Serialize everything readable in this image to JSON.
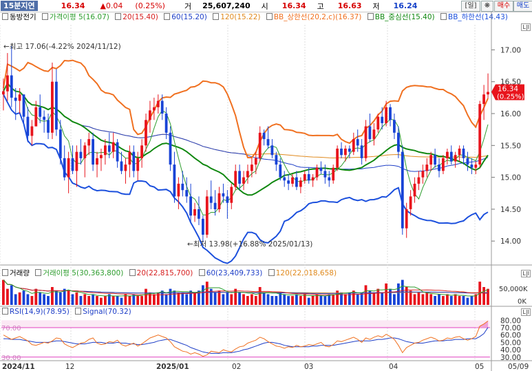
{
  "header": {
    "title": "15분지연",
    "price": "16.34",
    "change": "▲0.04",
    "change_pct": "(0.25%)",
    "volume_label": "거",
    "volume": "25,607,240",
    "open_label": "시",
    "open": "16.34",
    "high_label": "고",
    "high": "16.63",
    "low_label": "저",
    "low": "16.24",
    "period_button": "[일]",
    "settings_icon": "gear-icon",
    "buy_button": "매수",
    "sell_button": "매도"
  },
  "price_legend": {
    "stock_name": "동방전기",
    "items": [
      {
        "text": "가격이평 5(16.07)",
        "color": "#2e9d2e"
      },
      {
        "text": "20(15.40)",
        "color": "#d62020"
      },
      {
        "text": "60(15.20)",
        "color": "#1f3fc7"
      },
      {
        "text": "120(15.22)",
        "color": "#e08a1e"
      },
      {
        "text": "BB_상한선(20,2,c)(16.37)",
        "color": "#f07020"
      },
      {
        "text": "BB_중심선(15.40)",
        "color": "#118811"
      },
      {
        "text": "BB_하한선(14.43)",
        "color": "#1c50dd"
      }
    ]
  },
  "volume_legend": {
    "items": [
      {
        "text": "거래량",
        "color": "#000000"
      },
      {
        "text": "거래이평 5(30,363,800)",
        "color": "#2e9d2e"
      },
      {
        "text": "20(22,815,700)",
        "color": "#d62020"
      },
      {
        "text": "60(23,409,733)",
        "color": "#1f3fc7"
      },
      {
        "text": "120(22,018,658)",
        "color": "#e08a1e"
      }
    ]
  },
  "rsi_legend": {
    "items": [
      {
        "text": "RSI(14,9)(78.95)",
        "color": "#1f3fc7"
      },
      {
        "text": "Signal(70.32)",
        "color": "#1f3fc7"
      }
    ]
  },
  "annotations": {
    "high": "←최고 17.06(-4.22% 2024/11/12)",
    "low": "←최저 13.98(+16.88% 2025/01/13)"
  },
  "price_marker": {
    "value": "16.34",
    "pct": "(0.25%)"
  },
  "colors": {
    "up": "#e8141c",
    "down": "#1843d6"
  },
  "chart_data": {
    "type": "candlestick",
    "x_ticks": [
      "2024/11",
      "12",
      "2025/01",
      "02",
      "03",
      "04",
      "05",
      "05/09"
    ],
    "price_axis": {
      "ticks": [
        14.0,
        14.5,
        15.0,
        15.5,
        16.0,
        16.5,
        17.0
      ],
      "range": [
        13.7,
        17.35
      ]
    },
    "volume_axis": {
      "ticks": [
        "50,000K",
        "0K"
      ]
    },
    "rsi_axis": {
      "ticks": [
        30,
        40,
        50,
        60,
        70,
        80
      ],
      "range": [
        27,
        85
      ],
      "overbought": 70,
      "oversold": 30
    },
    "candles": [
      [
        16.3,
        16.55,
        16.05,
        16.35
      ],
      [
        16.35,
        16.95,
        16.2,
        16.6
      ],
      [
        16.6,
        17.06,
        16.1,
        16.25
      ],
      [
        16.25,
        16.4,
        15.9,
        16.2
      ],
      [
        16.2,
        16.4,
        16.0,
        16.3
      ],
      [
        16.3,
        16.3,
        15.85,
        15.95
      ],
      [
        15.95,
        16.1,
        15.55,
        15.65
      ],
      [
        15.65,
        15.9,
        15.5,
        15.8
      ],
      [
        15.8,
        16.2,
        15.8,
        16.1
      ],
      [
        16.1,
        16.3,
        15.85,
        15.95
      ],
      [
        15.95,
        16.05,
        15.7,
        15.9
      ],
      [
        15.9,
        16.0,
        15.6,
        15.7
      ],
      [
        15.7,
        16.8,
        15.6,
        16.5
      ],
      [
        16.5,
        16.7,
        15.65,
        15.75
      ],
      [
        15.75,
        15.9,
        15.2,
        15.3
      ],
      [
        15.3,
        15.5,
        14.95,
        15.0
      ],
      [
        15.0,
        15.4,
        14.75,
        15.3
      ],
      [
        15.3,
        15.5,
        15.05,
        15.1
      ],
      [
        15.1,
        15.5,
        14.85,
        15.4
      ],
      [
        15.4,
        15.6,
        15.2,
        15.3
      ],
      [
        15.3,
        15.55,
        15.0,
        15.5
      ],
      [
        15.5,
        15.7,
        15.35,
        15.6
      ],
      [
        15.6,
        15.7,
        15.1,
        15.2
      ],
      [
        15.2,
        15.4,
        15.0,
        15.3
      ],
      [
        15.3,
        15.45,
        15.1,
        15.35
      ],
      [
        15.35,
        15.6,
        15.2,
        15.5
      ],
      [
        15.5,
        15.7,
        15.3,
        15.4
      ],
      [
        15.4,
        15.7,
        15.3,
        15.55
      ],
      [
        15.55,
        15.6,
        15.15,
        15.25
      ],
      [
        15.25,
        15.4,
        15.05,
        15.1
      ],
      [
        15.1,
        15.3,
        14.9,
        15.2
      ],
      [
        15.2,
        15.5,
        15.0,
        15.4
      ],
      [
        15.4,
        15.5,
        15.0,
        15.1
      ],
      [
        15.1,
        15.4,
        14.95,
        15.3
      ],
      [
        15.3,
        15.6,
        15.15,
        15.5
      ],
      [
        15.5,
        16.0,
        15.4,
        15.9
      ],
      [
        15.9,
        16.2,
        15.7,
        16.05
      ],
      [
        16.05,
        16.25,
        15.9,
        16.1
      ],
      [
        16.1,
        16.3,
        16.0,
        16.2
      ],
      [
        16.2,
        16.3,
        15.9,
        16.0
      ],
      [
        16.0,
        16.1,
        15.6,
        15.7
      ],
      [
        15.7,
        15.8,
        15.1,
        15.2
      ],
      [
        15.2,
        15.4,
        14.6,
        14.7
      ],
      [
        14.7,
        15.0,
        14.5,
        14.9
      ],
      [
        14.9,
        15.1,
        14.7,
        14.8
      ],
      [
        14.8,
        15.0,
        14.6,
        14.7
      ],
      [
        14.7,
        14.9,
        14.3,
        14.4
      ],
      [
        14.4,
        14.6,
        14.3,
        14.5
      ],
      [
        14.5,
        14.7,
        14.25,
        14.35
      ],
      [
        14.35,
        14.4,
        13.98,
        14.1
      ],
      [
        14.1,
        14.8,
        14.05,
        14.7
      ],
      [
        14.7,
        14.95,
        14.5,
        14.6
      ],
      [
        14.6,
        14.8,
        14.4,
        14.5
      ],
      [
        14.5,
        14.85,
        14.45,
        14.75
      ],
      [
        14.75,
        14.9,
        14.6,
        14.7
      ],
      [
        14.7,
        14.8,
        14.35,
        14.6
      ],
      [
        14.6,
        14.9,
        14.5,
        14.85
      ],
      [
        14.85,
        15.2,
        14.8,
        15.1
      ],
      [
        15.1,
        15.2,
        14.8,
        14.9
      ],
      [
        14.9,
        15.1,
        14.8,
        15.0
      ],
      [
        15.0,
        15.2,
        14.9,
        15.1
      ],
      [
        15.1,
        15.3,
        15.0,
        15.2
      ],
      [
        15.2,
        15.4,
        15.05,
        15.3
      ],
      [
        15.3,
        15.8,
        15.25,
        15.7
      ],
      [
        15.7,
        15.75,
        15.5,
        15.6
      ],
      [
        15.6,
        15.8,
        15.45,
        15.5
      ],
      [
        15.5,
        15.6,
        15.3,
        15.35
      ],
      [
        15.35,
        15.4,
        15.1,
        15.2
      ],
      [
        15.2,
        15.3,
        14.95,
        15.0
      ],
      [
        15.0,
        15.1,
        14.85,
        14.95
      ],
      [
        14.95,
        15.05,
        14.8,
        14.9
      ],
      [
        14.9,
        15.05,
        14.85,
        15.0
      ],
      [
        15.0,
        15.1,
        14.8,
        14.85
      ],
      [
        14.85,
        15.0,
        14.75,
        14.95
      ],
      [
        14.95,
        15.1,
        14.9,
        15.05
      ],
      [
        15.05,
        15.15,
        14.9,
        14.95
      ],
      [
        14.95,
        15.05,
        14.85,
        15.0
      ],
      [
        15.0,
        15.2,
        14.95,
        15.15
      ],
      [
        15.15,
        15.25,
        15.05,
        15.1
      ],
      [
        15.1,
        15.2,
        14.9,
        15.0
      ],
      [
        15.0,
        15.1,
        14.85,
        14.95
      ],
      [
        14.95,
        15.2,
        14.9,
        15.15
      ],
      [
        15.15,
        15.5,
        15.1,
        15.45
      ],
      [
        15.45,
        15.55,
        15.3,
        15.35
      ],
      [
        15.35,
        15.5,
        15.25,
        15.45
      ],
      [
        15.45,
        15.5,
        15.3,
        15.4
      ],
      [
        15.4,
        15.7,
        15.35,
        15.6
      ],
      [
        15.6,
        15.75,
        15.4,
        15.5
      ],
      [
        15.5,
        15.6,
        15.2,
        15.3
      ],
      [
        15.3,
        15.9,
        15.25,
        15.8
      ],
      [
        15.8,
        16.0,
        15.55,
        15.6
      ],
      [
        15.6,
        15.85,
        15.5,
        15.75
      ],
      [
        15.75,
        16.0,
        15.7,
        15.95
      ],
      [
        15.95,
        16.1,
        15.75,
        15.85
      ],
      [
        15.85,
        16.2,
        15.8,
        16.1
      ],
      [
        16.1,
        16.15,
        15.8,
        15.9
      ],
      [
        15.9,
        16.0,
        15.6,
        15.7
      ],
      [
        15.7,
        15.8,
        15.3,
        15.4
      ],
      [
        15.4,
        15.5,
        14.1,
        14.2
      ],
      [
        14.2,
        14.6,
        14.05,
        14.5
      ],
      [
        14.5,
        14.8,
        14.4,
        14.7
      ],
      [
        14.7,
        15.0,
        14.6,
        14.9
      ],
      [
        14.9,
        15.1,
        14.8,
        15.0
      ],
      [
        15.0,
        15.2,
        14.9,
        15.1
      ],
      [
        15.1,
        15.3,
        15.0,
        15.2
      ],
      [
        15.2,
        15.4,
        15.1,
        15.35
      ],
      [
        15.35,
        15.45,
        15.15,
        15.2
      ],
      [
        15.2,
        15.3,
        15.0,
        15.1
      ],
      [
        15.1,
        15.35,
        15.05,
        15.3
      ],
      [
        15.3,
        15.45,
        15.2,
        15.4
      ],
      [
        15.4,
        15.5,
        15.2,
        15.25
      ],
      [
        15.25,
        15.4,
        15.15,
        15.35
      ],
      [
        15.35,
        15.5,
        15.25,
        15.45
      ],
      [
        15.45,
        15.5,
        15.2,
        15.3
      ],
      [
        15.3,
        15.4,
        15.1,
        15.2
      ],
      [
        15.2,
        15.3,
        15.05,
        15.15
      ],
      [
        15.15,
        15.25,
        15.05,
        15.2
      ],
      [
        15.2,
        16.2,
        15.15,
        16.15
      ],
      [
        16.15,
        16.45,
        15.9,
        16.3
      ],
      [
        16.3,
        16.63,
        16.24,
        16.34
      ]
    ],
    "volume": [
      1.4,
      0.9,
      1.1,
      0.6,
      0.7,
      0.8,
      0.6,
      0.5,
      0.9,
      0.7,
      0.6,
      0.5,
      1.0,
      0.8,
      0.7,
      0.9,
      0.8,
      0.6,
      0.7,
      0.5,
      0.6,
      0.5,
      0.6,
      0.5,
      0.4,
      0.5,
      0.6,
      0.5,
      0.5,
      0.4,
      0.6,
      0.5,
      0.6,
      0.5,
      0.5,
      0.9,
      0.7,
      0.6,
      0.7,
      0.8,
      0.6,
      0.9,
      0.8,
      0.7,
      0.7,
      0.6,
      0.8,
      0.7,
      0.8,
      1.1,
      1.3,
      0.9,
      0.7,
      0.8,
      0.6,
      0.7,
      0.6,
      0.9,
      0.7,
      0.6,
      0.5,
      0.6,
      0.5,
      1.0,
      0.7,
      0.6,
      0.5,
      0.5,
      0.7,
      0.6,
      0.5,
      0.5,
      0.6,
      0.5,
      0.6,
      0.4,
      0.5,
      0.6,
      0.5,
      0.5,
      0.6,
      0.6,
      0.8,
      0.7,
      0.6,
      0.7,
      0.8,
      0.6,
      0.7,
      1.1,
      0.8,
      0.7,
      0.9,
      0.7,
      1.2,
      0.9,
      0.6,
      1.2,
      1.4,
      1.0,
      0.8,
      0.6,
      0.7,
      0.6,
      0.7,
      0.6,
      0.5,
      0.6,
      0.5,
      0.6,
      0.5,
      0.6,
      0.5,
      0.5,
      0.4,
      0.5,
      0.6,
      1.3,
      1.0,
      0.9
    ],
    "rsi": [
      60,
      57,
      54,
      56,
      58,
      55,
      52,
      47,
      46,
      48,
      50,
      49,
      52,
      56,
      55,
      48,
      45,
      43,
      46,
      49,
      50,
      54,
      56,
      49,
      47,
      48,
      51,
      50,
      53,
      47,
      45,
      47,
      49,
      45,
      48,
      52,
      56,
      58,
      60,
      58,
      56,
      51,
      44,
      41,
      38,
      37,
      34,
      36,
      34,
      31,
      33,
      38,
      37,
      36,
      40,
      38,
      37,
      41,
      44,
      45,
      49,
      51,
      53,
      57,
      55,
      51,
      48,
      45,
      44,
      42,
      44,
      43,
      46,
      44,
      45,
      47,
      46,
      48,
      50,
      45,
      44,
      47,
      52,
      51,
      53,
      55,
      57,
      54,
      50,
      56,
      54,
      57,
      59,
      57,
      61,
      58,
      54,
      46,
      36,
      43,
      46,
      49,
      50,
      53,
      55,
      57,
      55,
      52,
      53,
      56,
      55,
      57,
      58,
      55,
      53,
      55,
      58,
      72,
      75,
      79
    ],
    "signal": [
      55,
      55,
      54,
      54,
      54,
      53,
      52,
      51,
      50,
      50,
      50,
      50,
      51,
      52,
      52,
      51,
      50,
      49,
      48,
      48,
      48,
      49,
      50,
      50,
      50,
      49,
      49,
      49,
      50,
      49,
      49,
      48,
      48,
      47,
      47,
      48,
      49,
      50,
      52,
      53,
      54,
      54,
      52,
      50,
      48,
      46,
      43,
      41,
      39,
      37,
      36,
      35,
      35,
      35,
      36,
      36,
      36,
      37,
      38,
      40,
      41,
      43,
      45,
      47,
      49,
      50,
      50,
      49,
      48,
      46,
      45,
      44,
      44,
      44,
      44,
      44,
      45,
      45,
      46,
      46,
      46,
      46,
      47,
      48,
      49,
      50,
      51,
      52,
      52,
      52,
      52,
      53,
      54,
      54,
      55,
      56,
      56,
      55,
      53,
      51,
      50,
      49,
      49,
      49,
      50,
      51,
      52,
      52,
      52,
      53,
      53,
      54,
      54,
      54,
      55,
      55,
      55,
      58,
      62,
      70.32
    ]
  }
}
